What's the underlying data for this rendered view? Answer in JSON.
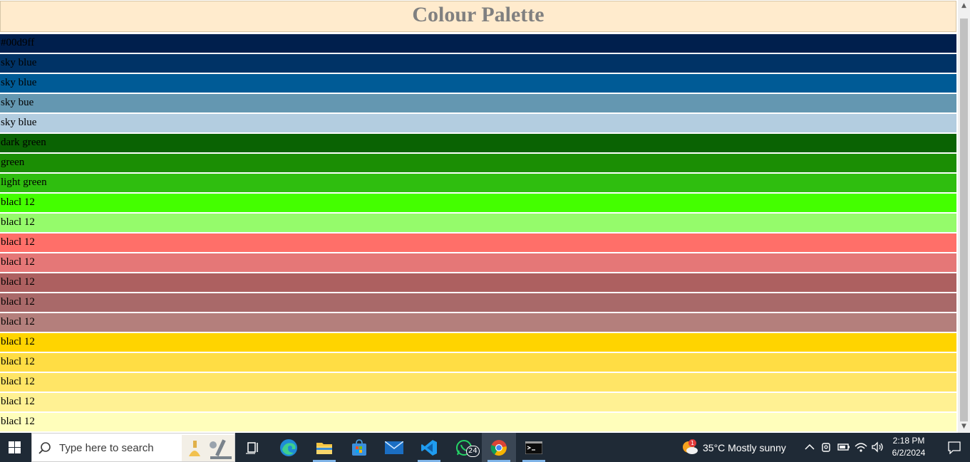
{
  "page": {
    "title": "Colour Palette"
  },
  "swatches": [
    {
      "label": "#00d9ff",
      "color": "#001f4d"
    },
    {
      "label": "sky blue",
      "color": "#003366"
    },
    {
      "label": "sky blue",
      "color": "#005b96"
    },
    {
      "label": "sky bue",
      "color": "#6497b1"
    },
    {
      "label": "sky blue",
      "color": "#b3cde0"
    },
    {
      "label": "dark green",
      "color": "#0a6303"
    },
    {
      "label": "green",
      "color": "#1b8e04"
    },
    {
      "label": "light green",
      "color": "#2fbe0f"
    },
    {
      "label": "blacl 12",
      "color": "#44ff00"
    },
    {
      "label": "blacl 12",
      "color": "#95fb6b"
    },
    {
      "label": "blacl 12",
      "color": "#ff6f69"
    },
    {
      "label": "blacl 12",
      "color": "#e57777"
    },
    {
      "label": "blacl 12",
      "color": "#ad6060"
    },
    {
      "label": "blacl 12",
      "color": "#a96969"
    },
    {
      "label": "blacl 12",
      "color": "#b47f7c"
    },
    {
      "label": "blacl 12",
      "color": "#ffd400"
    },
    {
      "label": "blacl 12",
      "color": "#ffdd44"
    },
    {
      "label": "blacl 12",
      "color": "#ffe566"
    },
    {
      "label": "blacl 12",
      "color": "#fff193"
    },
    {
      "label": "blacl 12",
      "color": "#fffebb"
    }
  ],
  "taskbar": {
    "search_placeholder": "Type here to search",
    "whatsapp_badge": "24",
    "weather_badge": "1",
    "weather_text": "35°C  Mostly sunny",
    "time": "2:18 PM",
    "date": "6/2/2024",
    "apps": [
      "task-view",
      "edge",
      "file-explorer",
      "microsoft-store",
      "mail",
      "vscode",
      "whatsapp",
      "chrome",
      "terminal"
    ]
  },
  "colors": {
    "header_bg": "#ffebcd",
    "title_text": "#808080",
    "taskbar_bg": "#1f2a36"
  }
}
